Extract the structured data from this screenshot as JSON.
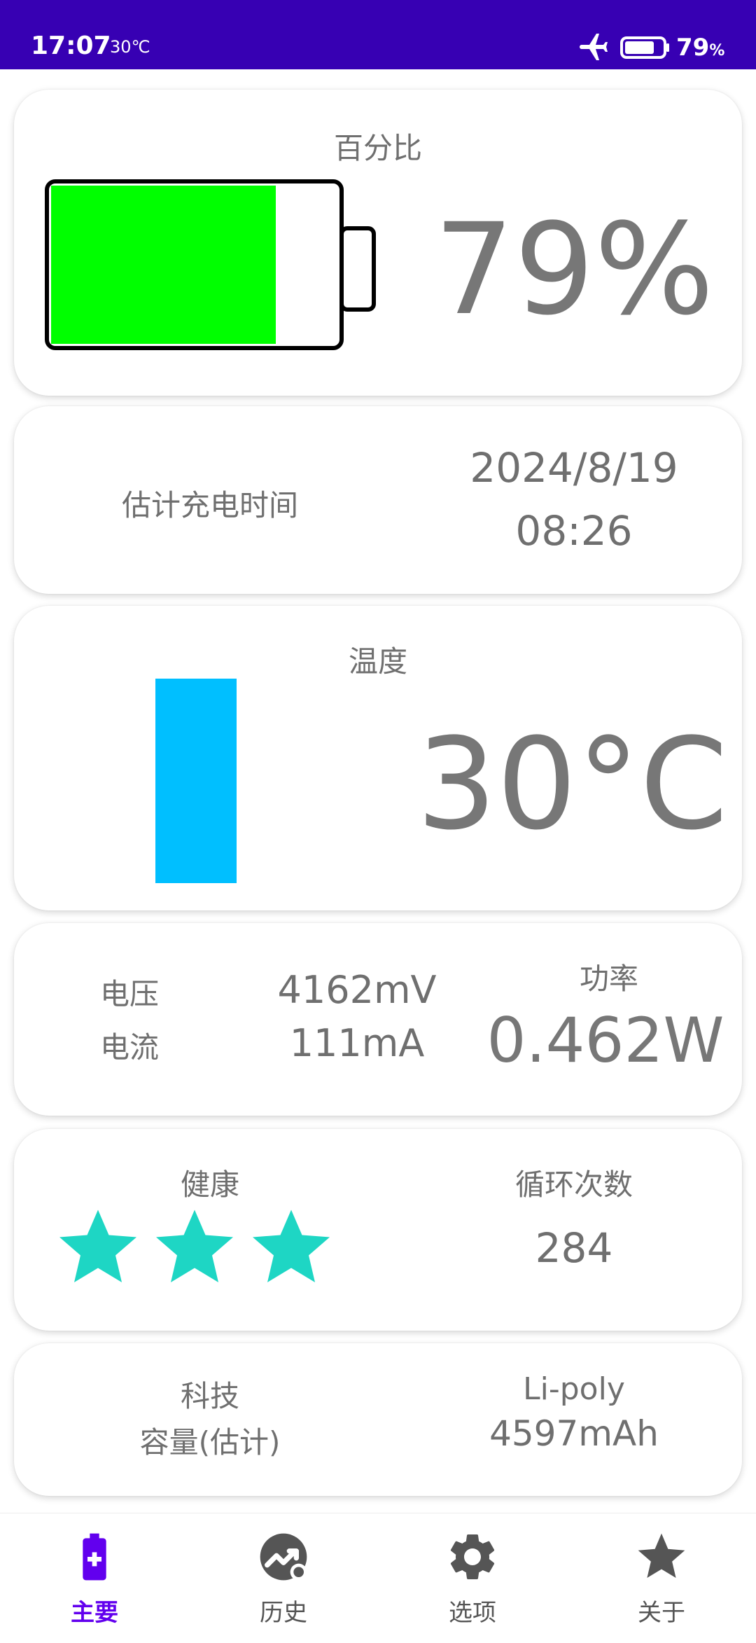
{
  "status_bar": {
    "time": "17:07",
    "temperature": "30℃",
    "battery_percent": "79",
    "battery_percent_sign": "%",
    "battery_level": 0.79,
    "icons": [
      "airplane-mode-icon",
      "battery-icon"
    ],
    "background_color": "#3700b3"
  },
  "percentage_card": {
    "label": "百分比",
    "value": "79%",
    "battery_fill_fraction": 0.78,
    "battery_fill_color": "#00ff00"
  },
  "charge_time_card": {
    "label": "估计充电时间",
    "date": "2024/8/19",
    "time": "08:26"
  },
  "temperature_card": {
    "label": "温度",
    "value": "30°C",
    "bar_color": "#00bfff"
  },
  "power_card": {
    "voltage_label": "电压",
    "voltage_value": "4162mV",
    "current_label": "电流",
    "current_value": "111mA",
    "power_label": "功率",
    "power_value": "0.462W"
  },
  "health_card": {
    "health_label": "健康",
    "health_stars": 3,
    "star_color": "#1ed6c4",
    "cycles_label": "循环次数",
    "cycles_value": "284"
  },
  "tech_card": {
    "tech_label": "科技",
    "tech_value": "Li-poly",
    "capacity_label": "容量(估计)",
    "capacity_value": "4597mAh"
  },
  "bottom_nav": {
    "items": [
      {
        "label": "主要",
        "icon": "battery-plus-icon",
        "active": true
      },
      {
        "label": "历史",
        "icon": "history-chart-icon",
        "active": false
      },
      {
        "label": "选项",
        "icon": "gear-icon",
        "active": false
      },
      {
        "label": "关于",
        "icon": "star-icon",
        "active": false
      }
    ],
    "active_color": "#6200ee"
  }
}
